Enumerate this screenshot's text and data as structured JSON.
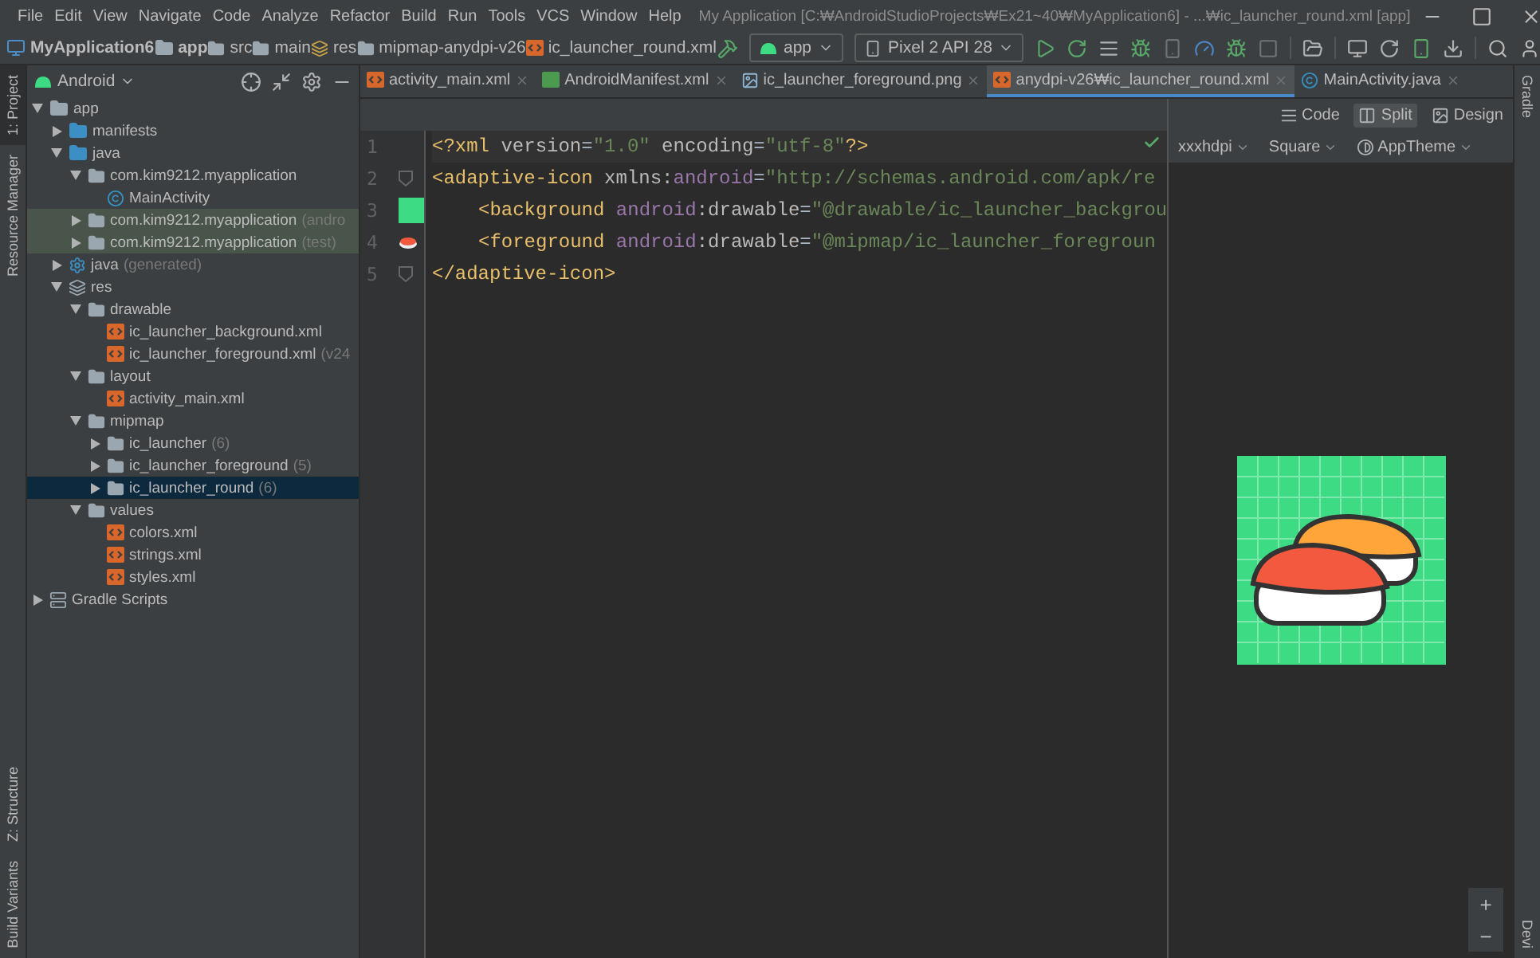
{
  "menu": [
    "File",
    "Edit",
    "View",
    "Navigate",
    "Code",
    "Analyze",
    "Refactor",
    "Build",
    "Run",
    "Tools",
    "VCS",
    "Window",
    "Help"
  ],
  "window_title": "My Application [C:₩AndroidStudioProjects₩Ex21~40₩MyApplication6] - ...₩ic_launcher_round.xml [app]",
  "breadcrumbs": [
    {
      "label": "MyApplication6",
      "kind": "project"
    },
    {
      "label": "app",
      "kind": "module"
    },
    {
      "label": "src",
      "kind": "folder"
    },
    {
      "label": "main",
      "kind": "folder"
    },
    {
      "label": "res",
      "kind": "res"
    },
    {
      "label": "mipmap-anydpi-v26",
      "kind": "folder"
    },
    {
      "label": "ic_launcher_round.xml",
      "kind": "xml"
    }
  ],
  "run_config": "app",
  "device": "Pixel 2 API 28",
  "side_left_top": [
    {
      "label": "1: Project",
      "selected": true
    },
    {
      "label": "Resource Manager",
      "selected": false
    }
  ],
  "side_left_bottom": [
    {
      "label": "Z: Structure"
    },
    {
      "label": "Build Variants"
    }
  ],
  "side_right": [
    "Gradle",
    "Devi"
  ],
  "project_view": "Android",
  "tree": [
    {
      "label": "app",
      "kind": "module",
      "expanded": true,
      "selected": false,
      "test": false,
      "children": [
        {
          "label": "manifests",
          "kind": "blue-folder",
          "expanded": false,
          "selected": false,
          "test": false
        },
        {
          "label": "java",
          "kind": "blue-folder",
          "expanded": true,
          "selected": false,
          "test": false,
          "children": [
            {
              "label": "com.kim9212.myapplication",
              "kind": "package",
              "expanded": true,
              "selected": false,
              "test": false,
              "children": [
                {
                  "label": "MainActivity",
                  "kind": "class",
                  "selected": false,
                  "test": false
                }
              ]
            },
            {
              "label": "com.kim9212.myapplication",
              "suffix": "(andro",
              "kind": "package",
              "expanded": false,
              "selected": false,
              "test": true
            },
            {
              "label": "com.kim9212.myapplication",
              "suffix": "(test)",
              "kind": "package",
              "expanded": false,
              "selected": false,
              "test": true
            }
          ]
        },
        {
          "label": "java",
          "suffix": "(generated)",
          "kind": "gen-folder",
          "expanded": false,
          "selected": false,
          "test": false
        },
        {
          "label": "res",
          "kind": "res-folder",
          "expanded": true,
          "selected": false,
          "test": false,
          "children": [
            {
              "label": "drawable",
              "kind": "package",
              "expanded": true,
              "selected": false,
              "test": false,
              "children": [
                {
                  "label": "ic_launcher_background.xml",
                  "kind": "xml",
                  "selected": false,
                  "test": false
                },
                {
                  "label": "ic_launcher_foreground.xml",
                  "suffix": "(v24",
                  "kind": "xml",
                  "selected": false,
                  "test": false
                }
              ]
            },
            {
              "label": "layout",
              "kind": "package",
              "expanded": true,
              "selected": false,
              "test": false,
              "children": [
                {
                  "label": "activity_main.xml",
                  "kind": "xml",
                  "selected": false,
                  "test": false
                }
              ]
            },
            {
              "label": "mipmap",
              "kind": "package",
              "expanded": true,
              "selected": false,
              "test": false,
              "children": [
                {
                  "label": "ic_launcher",
                  "suffix": "(6)",
                  "kind": "package",
                  "expanded": false,
                  "selected": false,
                  "test": false
                },
                {
                  "label": "ic_launcher_foreground",
                  "suffix": "(5)",
                  "kind": "package",
                  "expanded": false,
                  "selected": false,
                  "test": false
                },
                {
                  "label": "ic_launcher_round",
                  "suffix": "(6)",
                  "kind": "package",
                  "expanded": false,
                  "selected": true,
                  "test": false
                }
              ]
            },
            {
              "label": "values",
              "kind": "package",
              "expanded": true,
              "selected": false,
              "test": false,
              "children": [
                {
                  "label": "colors.xml",
                  "kind": "xml",
                  "selected": false,
                  "test": false
                },
                {
                  "label": "strings.xml",
                  "kind": "xml",
                  "selected": false,
                  "test": false
                },
                {
                  "label": "styles.xml",
                  "kind": "xml",
                  "selected": false,
                  "test": false
                }
              ]
            }
          ]
        }
      ]
    },
    {
      "label": "Gradle Scripts",
      "kind": "gradle",
      "expanded": false,
      "selected": false,
      "test": false
    }
  ],
  "tabs": [
    {
      "label": "activity_main.xml",
      "kind": "xml",
      "selected": false
    },
    {
      "label": "AndroidManifest.xml",
      "kind": "manifest",
      "selected": false
    },
    {
      "label": "ic_launcher_foreground.png",
      "kind": "image",
      "selected": false
    },
    {
      "label": "anydpi-v26₩ic_launcher_round.xml",
      "kind": "xml",
      "selected": true
    },
    {
      "label": "MainActivity.java",
      "kind": "class",
      "selected": false
    }
  ],
  "code": [
    {
      "number": "1",
      "indent": false,
      "kind": "plain",
      "tokens": [
        {
          "t": "<?xml ",
          "kind": "tag"
        },
        {
          "t": "version",
          "kind": "attr"
        },
        {
          "t": "=",
          "kind": "plain"
        },
        {
          "t": "\"1.0\"",
          "kind": "value"
        },
        {
          "t": " encoding",
          "kind": "attr"
        },
        {
          "t": "=",
          "kind": "plain"
        },
        {
          "t": "\"utf-8\"",
          "kind": "value"
        },
        {
          "t": "?>",
          "kind": "tag"
        }
      ]
    },
    {
      "number": "2",
      "indent": false,
      "kind": "fold",
      "tokens": [
        {
          "t": "<adaptive-icon ",
          "kind": "tag"
        },
        {
          "t": "xmlns:",
          "kind": "attr"
        },
        {
          "t": "android",
          "kind": "ns"
        },
        {
          "t": "=",
          "kind": "plain"
        },
        {
          "t": "\"http://schemas.android.com/apk/re",
          "kind": "value"
        }
      ]
    },
    {
      "number": "3",
      "indent": true,
      "kind": "swatch",
      "tokens": [
        {
          "t": "<background ",
          "kind": "tag"
        },
        {
          "t": "android",
          "kind": "ns"
        },
        {
          "t": ":drawable",
          "kind": "attr"
        },
        {
          "t": "=",
          "kind": "plain"
        },
        {
          "t": "\"@drawable/ic_launcher_backgrou",
          "kind": "value"
        }
      ]
    },
    {
      "number": "4",
      "indent": true,
      "kind": "image",
      "tokens": [
        {
          "t": "<foreground ",
          "kind": "tag"
        },
        {
          "t": "android",
          "kind": "ns"
        },
        {
          "t": ":drawable",
          "kind": "attr"
        },
        {
          "t": "=",
          "kind": "plain"
        },
        {
          "t": "\"@mipmap/ic_launcher_foregroun",
          "kind": "value"
        }
      ]
    },
    {
      "number": "5",
      "indent": false,
      "kind": "fold",
      "tokens": [
        {
          "t": "</adaptive-icon>",
          "kind": "tag"
        }
      ]
    }
  ],
  "view_modes": [
    {
      "label": "Code",
      "kind": "lines",
      "selected": false
    },
    {
      "label": "Split",
      "kind": "split",
      "selected": true
    },
    {
      "label": "Design",
      "kind": "image",
      "selected": false
    }
  ],
  "preview_options": [
    {
      "label": "xxxhdpi",
      "kind": "plain"
    },
    {
      "label": "Square",
      "kind": "plain"
    },
    {
      "label": "AppTheme",
      "kind": "theme"
    }
  ],
  "zoom_controls": [
    "+",
    "−"
  ]
}
